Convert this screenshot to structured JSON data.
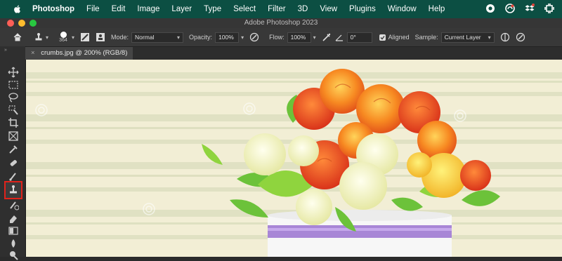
{
  "menubar": {
    "app_name": "Photoshop",
    "items": [
      "File",
      "Edit",
      "Image",
      "Layer",
      "Type",
      "Select",
      "Filter",
      "3D",
      "View",
      "Plugins",
      "Window",
      "Help"
    ],
    "background": "#0c4f43"
  },
  "window": {
    "title": "Adobe Photoshop 2023"
  },
  "options": {
    "brush_size": "364",
    "mode_label": "Mode:",
    "mode_value": "Normal",
    "opacity_label": "Opacity:",
    "opacity_value": "100%",
    "flow_label": "Flow:",
    "flow_value": "100%",
    "angle_value": "0°",
    "aligned_label": "Aligned",
    "aligned_checked": true,
    "sample_label": "Sample:",
    "sample_value": "Current Layer"
  },
  "document_tab": {
    "label": "crumbs.jpg @ 200% (RGB/8)"
  },
  "tools": [
    {
      "name": "move-tool-icon"
    },
    {
      "name": "marquee-tool-icon"
    },
    {
      "name": "lasso-tool-icon"
    },
    {
      "name": "quick-select-tool-icon"
    },
    {
      "name": "crop-tool-icon"
    },
    {
      "name": "frame-tool-icon"
    },
    {
      "name": "eyedropper-tool-icon"
    },
    {
      "name": "healing-brush-tool-icon"
    },
    {
      "name": "brush-tool-icon"
    },
    {
      "name": "clone-stamp-tool-icon",
      "selected": true
    },
    {
      "name": "history-brush-tool-icon"
    },
    {
      "name": "eraser-tool-icon"
    },
    {
      "name": "gradient-tool-icon"
    },
    {
      "name": "blur-tool-icon"
    },
    {
      "name": "dodge-tool-icon"
    }
  ],
  "highlight_color": "#e0221b"
}
